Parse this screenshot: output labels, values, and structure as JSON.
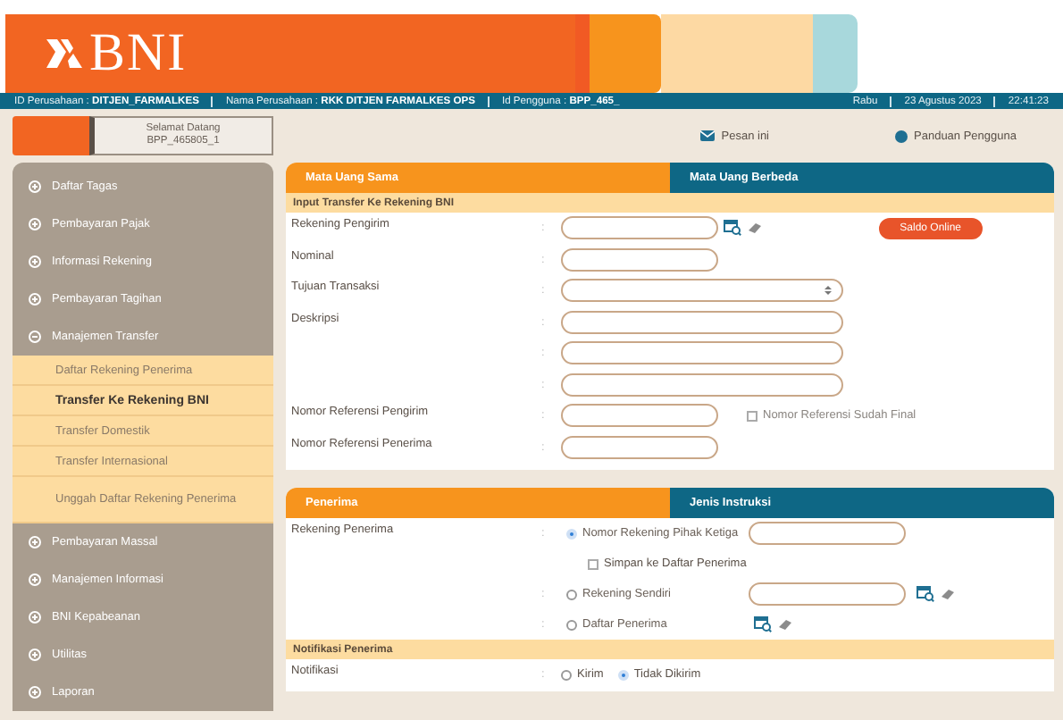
{
  "header": {
    "logo": "BNI"
  },
  "info_bar": {
    "company_id_label": "ID Perusahaan :",
    "company_id": "DITJEN_FARMALKES",
    "company_name_label": "Nama Perusahaan :",
    "company_name": "RKK DITJEN FARMALKES OPS",
    "user_id_label": "Id Pengguna :",
    "user_id": "BPP_465_",
    "day": "Rabu",
    "date": "23 Agustus 2023",
    "time": "22:41:23"
  },
  "welcome": {
    "title": "Selamat Datang",
    "user": "BPP_465805_1"
  },
  "top_links": [
    "Pesan ini",
    "Panduan Pengguna"
  ],
  "sidebar": {
    "items": [
      {
        "label": "Daftar Tagas",
        "expanded": false
      },
      {
        "label": "Pembayaran Pajak",
        "expanded": false
      },
      {
        "label": "Informasi Rekening",
        "expanded": false
      },
      {
        "label": "Pembayaran Tagihan",
        "expanded": false
      },
      {
        "label": "Manajemen Transfer",
        "expanded": true,
        "children": [
          {
            "label": "Daftar Rekening Penerima",
            "selected": false
          },
          {
            "label": "Transfer Ke Rekening BNI",
            "selected": true
          },
          {
            "label": "Transfer Domestik",
            "selected": false
          },
          {
            "label": "Transfer Internasional",
            "selected": false
          },
          {
            "label": "Unggah Daftar Rekening Penerima",
            "selected": false
          }
        ]
      },
      {
        "label": "Pembayaran Massal",
        "expanded": false
      },
      {
        "label": "Manajemen Informasi",
        "expanded": false
      },
      {
        "label": "BNI Kepabeanan",
        "expanded": false
      },
      {
        "label": "Utilitas",
        "expanded": false
      },
      {
        "label": "Laporan",
        "expanded": false
      }
    ]
  },
  "transfer_panel": {
    "tabs": [
      {
        "label": "Mata Uang Sama",
        "selected": true
      },
      {
        "label": "Mata Uang Berbeda",
        "selected": false
      }
    ],
    "section": "Input Transfer Ke Rekening BNI",
    "rows": [
      {
        "kind": "field",
        "label": "Rekening Pengirim",
        "separator": ":",
        "wide": false,
        "lookup": true,
        "button": "Saldo Online"
      },
      {
        "kind": "field",
        "label": "Nominal",
        "separator": ":",
        "wide": false
      },
      {
        "kind": "select",
        "label": "Tujuan Transaksi",
        "separator": ":",
        "wide": true
      },
      {
        "kind": "field",
        "label": "Deskripsi",
        "separator": ":",
        "wide": true
      },
      {
        "kind": "field",
        "separator": ":",
        "wide": true
      },
      {
        "kind": "field",
        "separator": ":",
        "wide": true
      },
      {
        "kind": "field",
        "label": "Nomor Referensi Pengirim",
        "separator": ":",
        "wide": false,
        "checkbox": {
          "label": "Nomor Referensi Sudah Final",
          "checked": false
        }
      },
      {
        "kind": "field",
        "label": "Nomor Referensi Penerima",
        "separator": ":",
        "wide": false
      }
    ]
  },
  "recipient_panel": {
    "tabs": [
      {
        "label": "Penerima",
        "selected": true
      },
      {
        "label": "Jenis Instruksi",
        "selected": false
      }
    ],
    "label": "Rekening Penerima",
    "options": [
      {
        "kind": "radio",
        "separator": ":",
        "label": "Nomor Rekening Pihak Ketiga",
        "selected": true,
        "field": true
      },
      {
        "kind": "checkbox",
        "label": "Simpan ke Daftar Penerima",
        "checked": false
      },
      {
        "kind": "radio",
        "separator": ":",
        "label": "Rekening Sendiri",
        "selected": false,
        "field": true,
        "lookup": true
      },
      {
        "kind": "radio",
        "separator": ":",
        "label": "Daftar Penerima",
        "selected": false,
        "lookup": true
      }
    ],
    "section": "Notifikasi Penerima",
    "notification": {
      "label": "Notifikasi",
      "separator": ":",
      "options": [
        {
          "label": "Kirim",
          "selected": false
        },
        {
          "label": "Tidak Dikirim",
          "selected": true
        }
      ]
    }
  }
}
